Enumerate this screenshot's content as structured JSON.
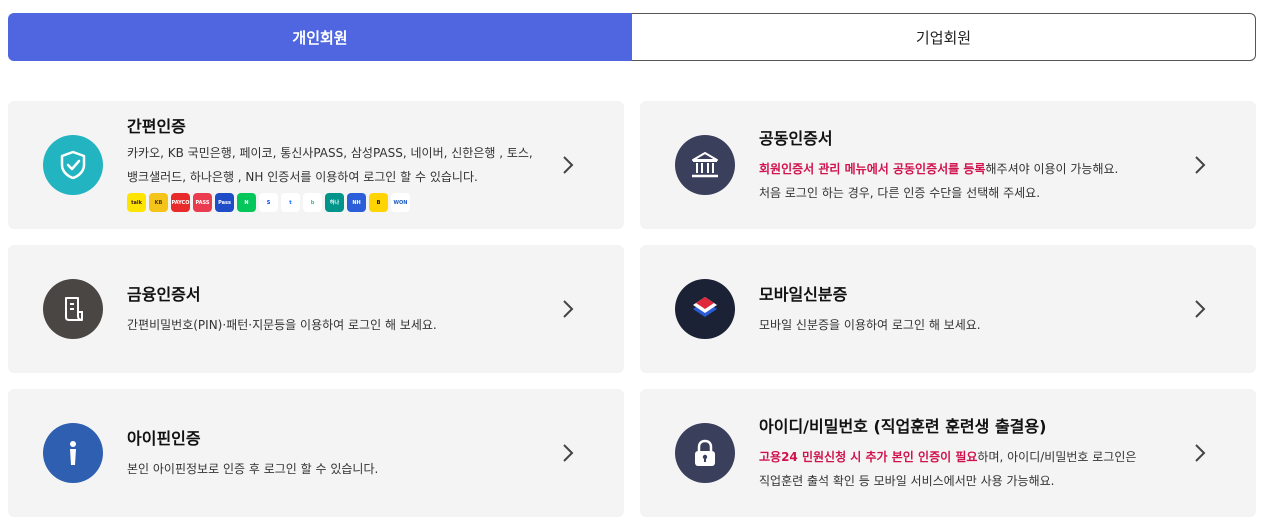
{
  "tabs": {
    "personal": "개인회원",
    "business": "기업회원"
  },
  "cards": {
    "simple": {
      "title": "간편인증",
      "desc_line1": "카카오, KB 국민은행, 페이코, 통신사PASS, 삼성PASS, 네이버, 신한은행 , 토스,",
      "desc_line2": "뱅크샐러드, 하나은행 , NH 인증서를 이용하여 로그인 할 수 있습니다.",
      "icon": "shield-check-icon",
      "color": "#22b4c0",
      "brands": [
        {
          "name": "kakao-icon",
          "label": "talk",
          "color": "#fee500",
          "text": "#3a1d1d"
        },
        {
          "name": "kb-icon",
          "label": "KB",
          "color": "#f5c41a",
          "text": "#4a3a00"
        },
        {
          "name": "payco-icon",
          "label": "PAYCO",
          "color": "#e92a2a",
          "text": "#ffffff"
        },
        {
          "name": "pass-icon",
          "label": "PASS",
          "color": "#ea3b4f",
          "text": "#ffffff"
        },
        {
          "name": "samsung-pass-icon",
          "label": "Pass",
          "color": "#1f4cc7",
          "text": "#ffffff"
        },
        {
          "name": "naver-icon",
          "label": "N",
          "color": "#03c75a",
          "text": "#ffffff"
        },
        {
          "name": "shinhan-icon",
          "label": "S",
          "color": "#ffffff",
          "text": "#0046ff"
        },
        {
          "name": "toss-icon",
          "label": "t",
          "color": "#ffffff",
          "text": "#0064ff"
        },
        {
          "name": "banksalad-icon",
          "label": "b",
          "color": "#ffffff",
          "text": "#2ec27e"
        },
        {
          "name": "hana-icon",
          "label": "하나",
          "color": "#00948a",
          "text": "#ffffff"
        },
        {
          "name": "nh-icon",
          "label": "NH",
          "color": "#2b5fd9",
          "text": "#ffffff"
        },
        {
          "name": "b-icon",
          "label": "B",
          "color": "#ffd400",
          "text": "#111111"
        },
        {
          "name": "woori-icon",
          "label": "WON",
          "color": "#ffffff",
          "text": "#1e5bbf"
        }
      ]
    },
    "joint": {
      "title": "공동인증서",
      "desc_hl": "회원인증서 관리 메뉴에서 공동인증서를 등록",
      "desc_rest": "해주셔야 이용이 가능해요.",
      "desc_line2": "처음 로그인 하는 경우, 다른 인증 수단을 선택해 주세요.",
      "icon": "bank-icon",
      "color": "#3a3f5c"
    },
    "finance": {
      "title": "금융인증서",
      "desc": "간편비밀번호(PIN)·패턴·지문등을 이용하여 로그인 해 보세요.",
      "icon": "document-icon",
      "color": "#4a4644"
    },
    "mobile": {
      "title": "모바일신분증",
      "desc": "모바일 신분증을 이용하여 로그인 해 보세요.",
      "icon": "mobile-id-icon",
      "color": "#1c2235"
    },
    "ipin": {
      "title": "아이핀인증",
      "desc": "본인 아이핀정보로 인증 후 로그인 할 수 있습니다.",
      "icon": "info-icon",
      "color": "#2e5fb0"
    },
    "idpw": {
      "title": "아이디/비밀번호 (직업훈련 훈련생 출결용)",
      "desc_hl": "고용24 민원신청 시 추가 본인 인증이 필요",
      "desc_rest": "하며, 아이디/비밀번호 로그인은",
      "desc_line2": "직업훈련 출석 확인 등 모바일 서비스에서만 사용 가능해요.",
      "icon": "lock-icon",
      "color": "#3a3f5c"
    }
  }
}
